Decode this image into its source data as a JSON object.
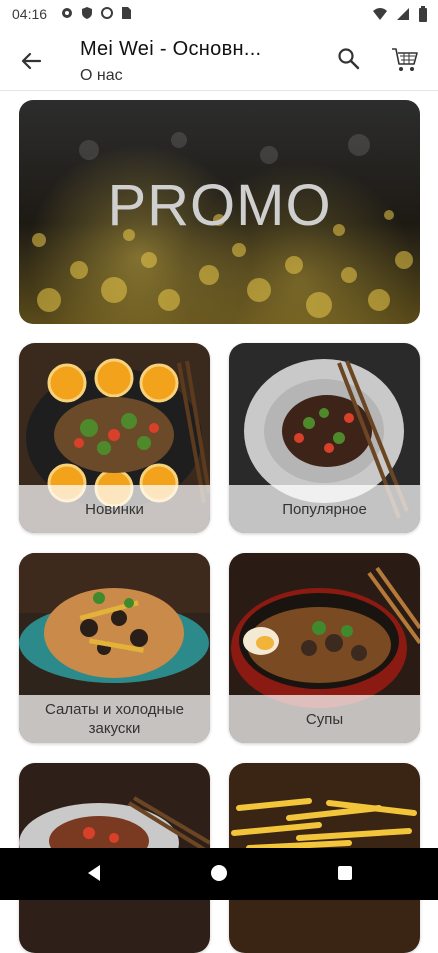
{
  "status_bar": {
    "time": "04:16",
    "icons": [
      "gear-icon",
      "shield-icon",
      "sync-icon",
      "sim-icon",
      "wifi-icon",
      "signal-icon",
      "battery-icon"
    ]
  },
  "app_bar": {
    "title": "Mei Wei - Основн...",
    "subtitle": "О нас",
    "icons": [
      "back-arrow-icon",
      "search-icon",
      "cart-icon"
    ]
  },
  "promo": {
    "text": "PROMO"
  },
  "categories": [
    {
      "label": "Новинки"
    },
    {
      "label": "Популярное"
    },
    {
      "label": "Салаты и холодные закуски"
    },
    {
      "label": "Супы"
    },
    {
      "label": ""
    },
    {
      "label": ""
    }
  ],
  "colors": {
    "nav_bar": "#000000",
    "card_label_overlay": "#ffffffb8",
    "promo_text": "#cfcfcf"
  }
}
